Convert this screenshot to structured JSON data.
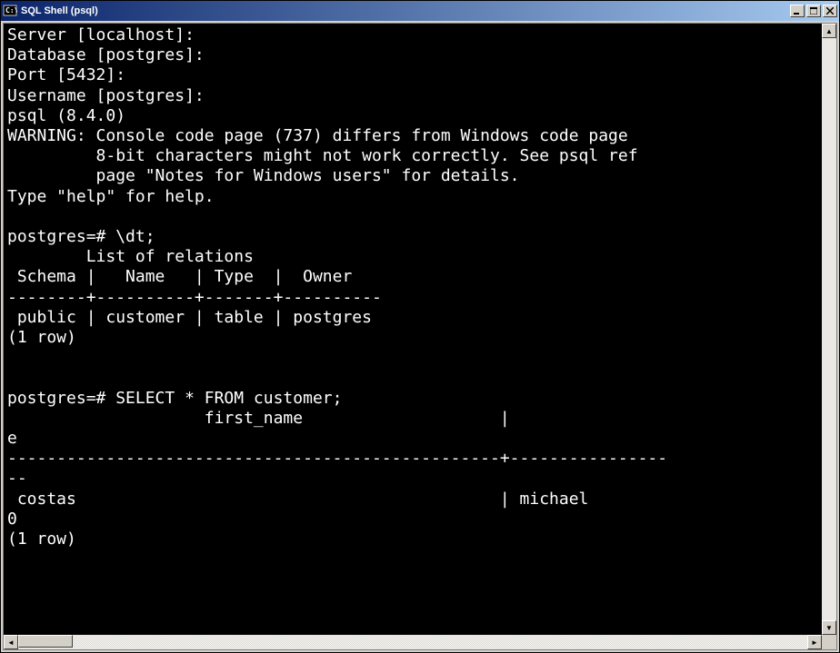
{
  "window": {
    "title": "SQL Shell (psql)"
  },
  "prompts": {
    "server": "Server [localhost]:",
    "database": "Database [postgres]:",
    "port": "Port [5432]:",
    "username": "Username [postgres]:",
    "version": "psql (8.4.0)",
    "warning1": "WARNING: Console code page (737) differs from Windows code page ",
    "warning2": "         8-bit characters might not work correctly. See psql ref",
    "warning3": "         page \"Notes for Windows users\" for details.",
    "help": "Type \"help\" for help.",
    "blank": ""
  },
  "dt": {
    "cmd": "postgres=# \\dt;",
    "title": "        List of relations",
    "header": " Schema |   Name   | Type  |  Owner",
    "sep": "--------+----------+-------+----------",
    "row": " public | customer | table | postgres",
    "count": "(1 row)"
  },
  "select": {
    "cmd": "postgres=# SELECT * FROM customer;",
    "header": "                    first_name                    |        ",
    "header2": "e",
    "sep": "--------------------------------------------------+----------------",
    "sep2": "--",
    "row": " costas                                           | michael",
    "row2": "0",
    "count": "(1 row)"
  },
  "buttons": {
    "min": "_",
    "max": "□",
    "close": "×",
    "up": "▲",
    "down": "▼",
    "left": "◄",
    "right": "►"
  }
}
